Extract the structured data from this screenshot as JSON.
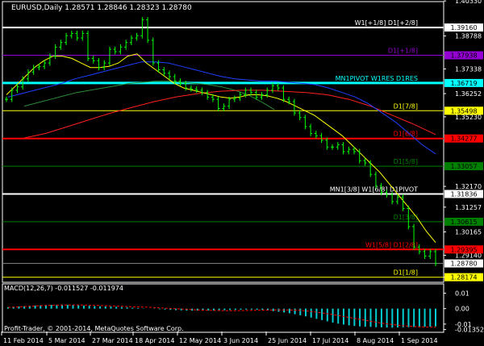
{
  "chart_data": {
    "type": "line",
    "title": "EURUSD,Daily  1.28571 1.28846 1.28323 1.28780",
    "symbol": "EURUSD",
    "timeframe": "Daily",
    "ohlc_last": {
      "open": 1.28571,
      "high": 1.28846,
      "low": 1.28323,
      "close": 1.2878
    },
    "main_ylim": [
      1.2795,
      1.403
    ],
    "y_ticks": [
      "1.40330",
      "1.38788",
      "1.37338",
      "1.36252",
      "1.35230",
      "1.31257",
      "1.32170",
      "1.30165",
      "1.29140",
      "1.28174"
    ],
    "x_ticks": [
      "11 Feb 2014",
      "5 Mar 2014",
      "27 Mar 2014",
      "18 Apr 2014",
      "12 May 2014",
      "3 Jun 2014",
      "25 Jun 2014",
      "17 Jul 2014",
      "8 Aug 2014",
      "1 Sep 2014"
    ],
    "levels": [
      {
        "label": "W1[+1/8] D1[+2/8]",
        "value": 1.3916,
        "price": "1.39160",
        "color": "#ffffff",
        "width": 2
      },
      {
        "label": "D1[+1/8]",
        "value": 1.37938,
        "price": "1.37938",
        "color": "#9400d3",
        "width": 1
      },
      {
        "label": "MN1PIVOT W1RES D1RES",
        "value": 1.36719,
        "price": "1.36719",
        "color": "#00ffff",
        "width": 3
      },
      {
        "label": "D1[7/8]",
        "value": 1.35498,
        "price": "1.35498",
        "color": "#ffff00",
        "width": 1
      },
      {
        "label": "D1[6/8]",
        "value": 1.34277,
        "price": "1.34277",
        "color": "#ff0000",
        "width": 2
      },
      {
        "label": "D1[5/8]",
        "value": 1.33057,
        "price": "1.33057",
        "color": "#008000",
        "width": 1
      },
      {
        "label": "MN1[3/8] W1[6/8] D1PIVOT",
        "value": 1.31836,
        "price": "1.31836",
        "color": "#ffffff",
        "width": 2
      },
      {
        "label": "D1[3/8]",
        "value": 1.30615,
        "price": "1.30615",
        "color": "#008000",
        "width": 1
      },
      {
        "label": "W1[5/8] D1[2/8]",
        "value": 1.29395,
        "price": "1.29395",
        "color": "#ff0000",
        "width": 2
      },
      {
        "label": "D1[1/8]",
        "value": 1.28174,
        "price": "1.28174",
        "color": "#ffff00",
        "width": 1
      }
    ],
    "current_price": "1.28780",
    "series": [
      {
        "name": "EURUSD",
        "color": "#00ff00",
        "values": [
          1.36,
          1.364,
          1.3655,
          1.369,
          1.372,
          1.374,
          1.3745,
          1.376,
          1.379,
          1.383,
          1.385,
          1.388,
          1.389,
          1.387,
          1.389,
          1.378,
          1.377,
          1.374,
          1.376,
          1.382,
          1.381,
          1.383,
          1.385,
          1.387,
          1.388,
          1.395,
          1.386,
          1.376,
          1.373,
          1.3715,
          1.37,
          1.368,
          1.367,
          1.365,
          1.3645,
          1.364,
          1.363,
          1.361,
          1.36,
          1.356,
          1.357,
          1.36,
          1.3605,
          1.362,
          1.364,
          1.363,
          1.361,
          1.362,
          1.364,
          1.366,
          1.365,
          1.36,
          1.359,
          1.354,
          1.352,
          1.348,
          1.345,
          1.344,
          1.342,
          1.339,
          1.339,
          1.34,
          1.337,
          1.338,
          1.337,
          1.333,
          1.332,
          1.327,
          1.322,
          1.319,
          1.318,
          1.315,
          1.317,
          1.312,
          1.304,
          1.295,
          1.293,
          1.291,
          1.293,
          1.2878
        ]
      },
      {
        "name": "MA fast",
        "color": "#ffff00",
        "values": [
          1.362,
          1.366,
          1.37,
          1.374,
          1.377,
          1.379,
          1.379,
          1.378,
          1.376,
          1.374,
          1.374,
          1.3745,
          1.376,
          1.379,
          1.38,
          1.376,
          1.373,
          1.37,
          1.367,
          1.365,
          1.364,
          1.363,
          1.362,
          1.361,
          1.3605,
          1.361,
          1.362,
          1.362,
          1.3615,
          1.3605,
          1.359,
          1.357,
          1.355,
          1.353,
          1.35,
          1.347,
          1.344,
          1.34,
          1.336,
          1.332,
          1.328,
          1.323,
          1.318,
          1.313,
          1.308,
          1.302,
          1.297
        ]
      },
      {
        "name": "MA slow",
        "color": "#1f3fff",
        "values": [
          1.361,
          1.3625,
          1.364,
          1.3655,
          1.367,
          1.369,
          1.3705,
          1.372,
          1.3735,
          1.375,
          1.3765,
          1.3765,
          1.376,
          1.3745,
          1.373,
          1.3715,
          1.37,
          1.369,
          1.3685,
          1.368,
          1.368,
          1.3675,
          1.367,
          1.3665,
          1.365,
          1.363,
          1.361,
          1.358,
          1.354,
          1.35,
          1.345,
          1.34,
          1.336
        ]
      },
      {
        "name": "MA long",
        "color": "#2e8b3a",
        "values": [
          1.357,
          1.3585,
          1.36,
          1.3615,
          1.363,
          1.364,
          1.365,
          1.366,
          1.367,
          1.3675,
          1.368,
          1.368,
          1.3675,
          1.367,
          1.3665,
          1.3655,
          1.364,
          1.362,
          1.359,
          1.3555
        ]
      },
      {
        "name": "MA trend",
        "color": "#ff2020",
        "values": [
          1.343,
          1.345,
          1.348,
          1.351,
          1.354,
          1.3565,
          1.359,
          1.361,
          1.3625,
          1.3635,
          1.364,
          1.364,
          1.3635,
          1.363,
          1.362,
          1.36,
          1.357,
          1.353,
          1.349,
          1.3445
        ]
      }
    ],
    "macd": {
      "label": "MACD(12,26,7) -0.011527 -0.011974",
      "ylim": [
        -0.0153,
        0.016
      ],
      "ticks": [
        "0.01",
        "0.00",
        "-0.01",
        "-0.013520"
      ],
      "histogram_color": "#00ced1",
      "signal_color": "#ff0000",
      "histogram": [
        0.001,
        0.0012,
        0.0014,
        0.0016,
        0.0018,
        0.002,
        0.0022,
        0.0023,
        0.0024,
        0.0025,
        0.0026,
        0.0025,
        0.0024,
        0.0022,
        0.002,
        0.0018,
        0.0016,
        0.0015,
        0.0014,
        0.0013,
        0.0012,
        0.001,
        0.0008,
        0.0006,
        0.0004,
        0.0002,
        0.0,
        -0.0002,
        -0.0004,
        -0.0006,
        -0.0008,
        -0.001,
        -0.0011,
        -0.0012,
        -0.0013,
        -0.0013,
        -0.0013,
        -0.0012,
        -0.0012,
        -0.0011,
        -0.001,
        -0.0009,
        -0.0008,
        -0.0007,
        -0.0006,
        -0.0006,
        -0.0007,
        -0.0009,
        -0.0012,
        -0.0016,
        -0.002,
        -0.0025,
        -0.003,
        -0.0036,
        -0.0043,
        -0.005,
        -0.0058,
        -0.0066,
        -0.0074,
        -0.0082,
        -0.009,
        -0.0097,
        -0.0103,
        -0.0108,
        -0.0112,
        -0.0115,
        -0.0117,
        -0.0118,
        -0.012,
        -0.0121,
        -0.0122,
        -0.0123,
        -0.0122,
        -0.0121,
        -0.012,
        -0.0119,
        -0.0118,
        -0.0117,
        -0.0116,
        -0.0115
      ],
      "signal": [
        0.0008,
        0.0011,
        0.0014,
        0.0017,
        0.002,
        0.0022,
        0.0023,
        0.0024,
        0.0024,
        0.0023,
        0.0021,
        0.0019,
        0.0017,
        0.0015,
        0.0013,
        0.0011,
        0.0009,
        0.0006,
        0.0003,
        0.0,
        -0.0003,
        -0.0006,
        -0.0009,
        -0.0011,
        -0.0012,
        -0.0013,
        -0.0013,
        -0.0012,
        -0.0011,
        -0.001,
        -0.0009,
        -0.0008,
        -0.0008,
        -0.001,
        -0.0014,
        -0.002,
        -0.0028,
        -0.0036,
        -0.0046,
        -0.0056,
        -0.0066,
        -0.0076,
        -0.0086,
        -0.0095,
        -0.0103,
        -0.0109,
        -0.0114,
        -0.0117,
        -0.0119,
        -0.012
      ]
    },
    "copyright": "Profit-Trader, © 2001-2014, MetaQuotes Software Corp."
  }
}
